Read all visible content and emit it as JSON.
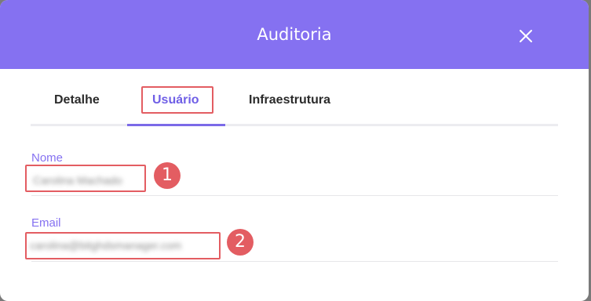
{
  "modal": {
    "title": "Auditoria",
    "close_icon": "close-icon"
  },
  "tabs": [
    {
      "label": "Detalhe",
      "active": false
    },
    {
      "label": "Usuário",
      "active": true
    },
    {
      "label": "Infraestrutura",
      "active": false
    }
  ],
  "fields": {
    "name": {
      "label": "Nome",
      "value": "Carolina Machado"
    },
    "email": {
      "label": "Email",
      "value": "carolina@bitghdsmanager.com"
    }
  },
  "markers": [
    "1",
    "2"
  ],
  "colors": {
    "header": "#8571f1",
    "accent": "#7b6ae8",
    "highlight": "#e35d62"
  }
}
